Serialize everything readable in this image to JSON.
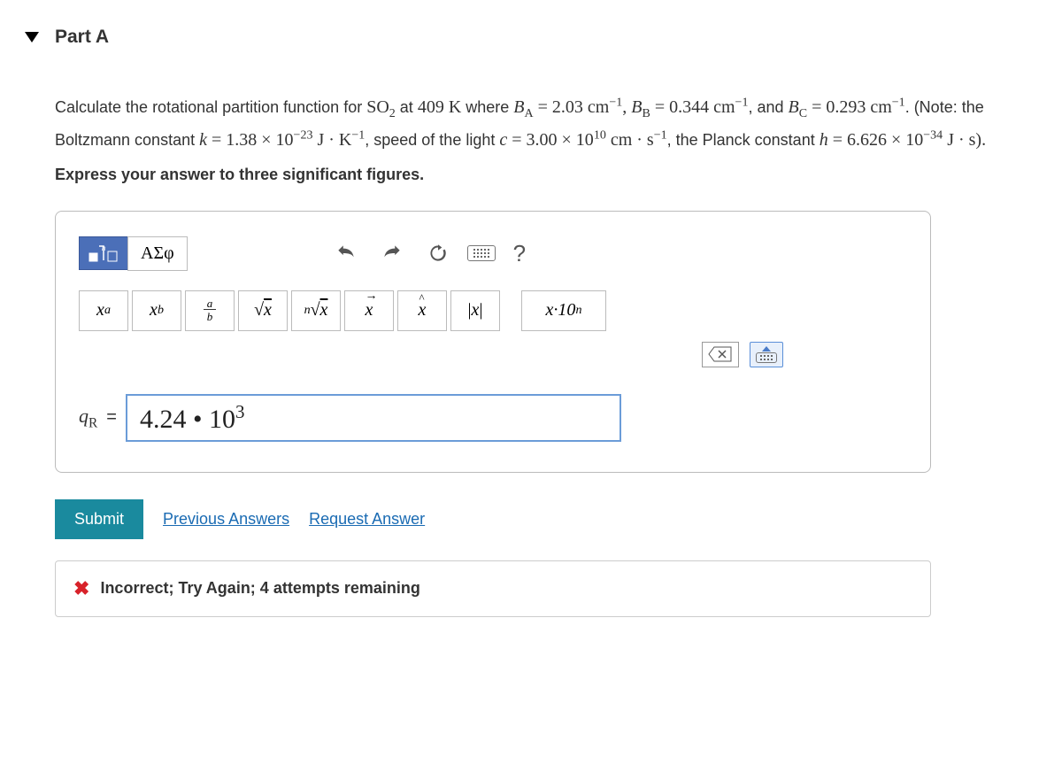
{
  "part": {
    "label": "Part A"
  },
  "question": {
    "html_segments": {
      "pre1": "Calculate the rotational partition function for ",
      "so2_base": "SO",
      "so2_sub": "2",
      "mid1": " at ",
      "temp": "409 K",
      "mid2": " where ",
      "ba_sym": "B",
      "ba_sub": "A",
      "eq": " = ",
      "ba_val": "2.03 cm",
      "ba_exp": "−1",
      "comma": ", ",
      "bb_sym": "B",
      "bb_sub": "B",
      "bb_val": "0.344 cm",
      "bb_exp": "−1",
      "and": ", and ",
      "bc_sym": "B",
      "bc_sub": "C",
      "bc_val": "0.293 cm",
      "bc_exp": "−1",
      "note_open": ". (Note: the Boltzmann constant ",
      "k_sym": "k",
      "k_val": "1.38 × 10",
      "k_exp": "−23",
      "k_unit1": " J · K",
      "k_unit_exp": "−1",
      "note_mid": ", speed of the light ",
      "c_sym": "c",
      "c_val": "3.00 × 10",
      "c_exp": "10",
      "c_unit": " cm · s",
      "c_unit_exp": "−1",
      "note_mid2": ", the Planck constant ",
      "h_sym": "h",
      "h_val": "6.626 × 10",
      "h_exp": "−34",
      "h_unit": " J · s).",
      "instruction": "Express your answer to three significant figures."
    }
  },
  "toolbar": {
    "greek_label": "ΑΣφ",
    "math_buttons": {
      "superscript_x": "x",
      "superscript_a": "a",
      "subscript_x": "x",
      "subscript_b": "b",
      "frac_a": "a",
      "frac_b": "b",
      "sqrt": "√",
      "sqrt_x": "x",
      "nth_n": "n",
      "nth_x": "x",
      "vec_x": "x",
      "hat_x": "x",
      "abs_x": "|x|",
      "sci_label": "x·10",
      "sci_exp": "n"
    },
    "help": "?"
  },
  "entry": {
    "label_base": "q",
    "label_sub": "R",
    "equals": "=",
    "value_display": "4.24 • 10³",
    "value_coef": "4.24",
    "value_exp": "3"
  },
  "buttons": {
    "submit": "Submit",
    "prev": "Previous Answers",
    "request": "Request Answer"
  },
  "feedback": {
    "text": "Incorrect; Try Again; 4 attempts remaining"
  }
}
